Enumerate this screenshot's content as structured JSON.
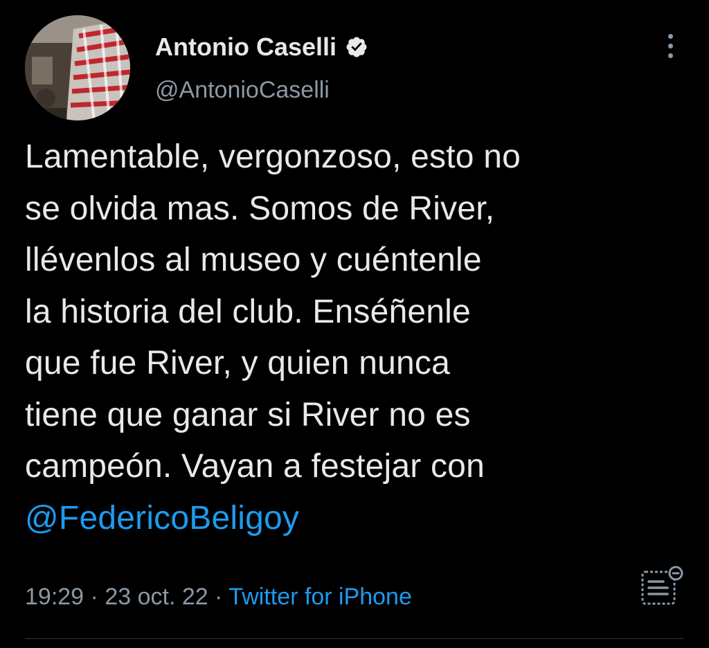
{
  "author": {
    "display_name": "Antonio Caselli",
    "handle": "@AntonioCaselli",
    "verified_icon": "verified-badge-icon",
    "avatar_icon": "avatar-photo"
  },
  "tweet": {
    "lines": [
      "Lamentable, vergonzoso, esto no",
      "se olvida mas. Somos de River,",
      "llévenlos al museo y cuéntenle",
      "la historia del club. Enséñenle",
      "que fue River, y quien nunca",
      "tiene que ganar si River no es",
      "campeón. Vayan a festejar con"
    ],
    "mention": "@FedericoBeligoy"
  },
  "meta": {
    "time": "19:29",
    "separator": "·",
    "date": "23 oct. 22",
    "source": "Twitter for iPhone"
  },
  "icons": {
    "more": "more-vertical-icon",
    "analytics": "view-analytics-icon"
  },
  "colors": {
    "background": "#000000",
    "text": "#e7e9ea",
    "secondary": "#8b98a5",
    "accent": "#1d9bf0",
    "divider": "#2f3336"
  }
}
